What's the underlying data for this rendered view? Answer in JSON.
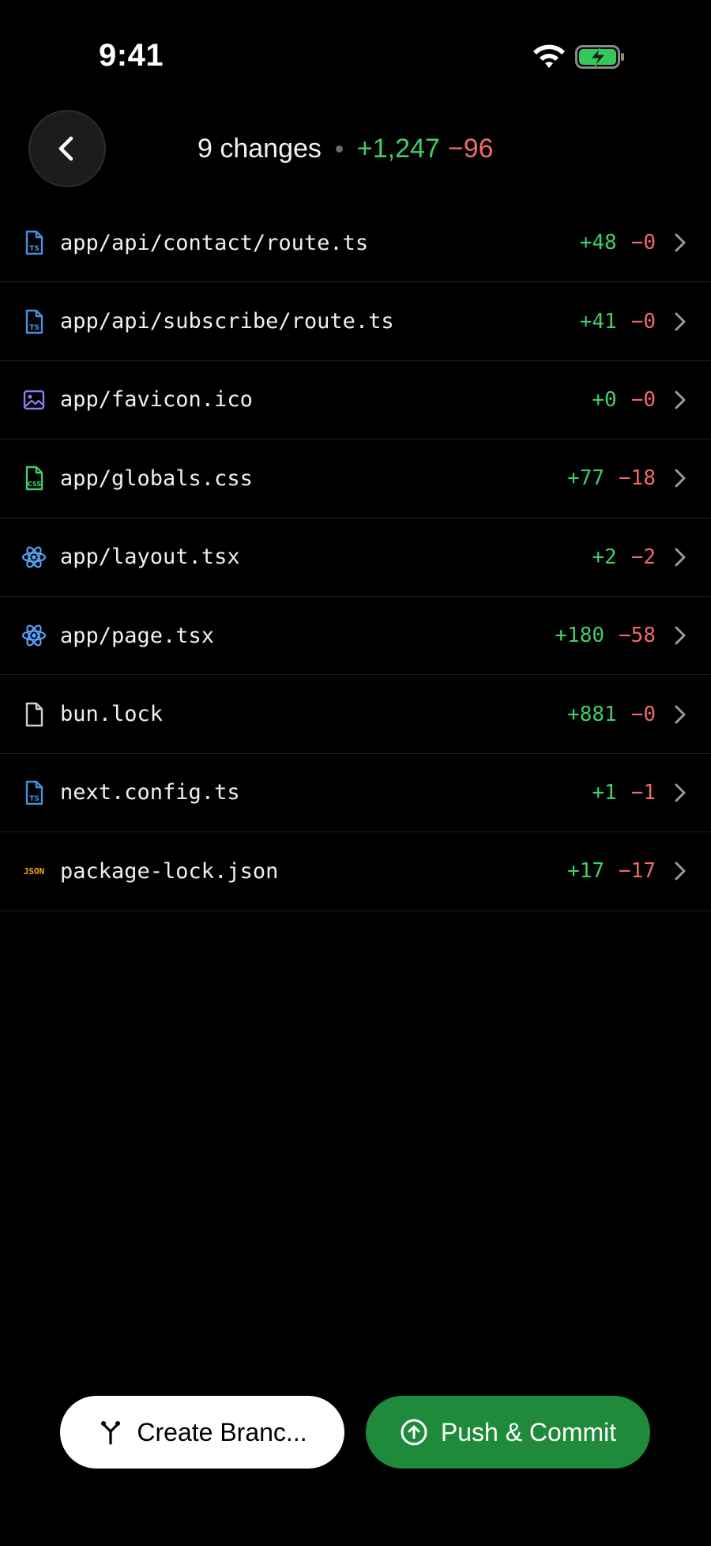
{
  "status_bar": {
    "time": "9:41"
  },
  "header": {
    "changes_label": "9 changes",
    "additions": "+1,247",
    "deletions": "−96"
  },
  "files": [
    {
      "icon": "typescript-file-icon",
      "name": "app/api/contact/route.ts",
      "add": "+48",
      "del": "−0"
    },
    {
      "icon": "typescript-file-icon",
      "name": "app/api/subscribe/route.ts",
      "add": "+41",
      "del": "−0"
    },
    {
      "icon": "image-file-icon",
      "name": "app/favicon.ico",
      "add": "+0",
      "del": "−0"
    },
    {
      "icon": "css-file-icon",
      "name": "app/globals.css",
      "add": "+77",
      "del": "−18"
    },
    {
      "icon": "react-file-icon",
      "name": "app/layout.tsx",
      "add": "+2",
      "del": "−2"
    },
    {
      "icon": "react-file-icon",
      "name": "app/page.tsx",
      "add": "+180",
      "del": "−58"
    },
    {
      "icon": "generic-file-icon",
      "name": "bun.lock",
      "add": "+881",
      "del": "−0"
    },
    {
      "icon": "typescript-file-icon",
      "name": "next.config.ts",
      "add": "+1",
      "del": "−1"
    },
    {
      "icon": "json-file-icon",
      "name": "package-lock.json",
      "add": "+17",
      "del": "−17"
    }
  ],
  "actions": {
    "create_branch_label": "Create Branc...",
    "push_commit_label": "Push & Commit"
  },
  "colors": {
    "addition": "#3fcf6a",
    "deletion": "#f06a6a",
    "push_button": "#1f8a3a",
    "typescript_icon": "#4a90e2",
    "css_icon": "#3fcf6a",
    "react_icon": "#5aa0f0",
    "json_icon": "#f5a623",
    "image_icon": "#8e7cf0"
  }
}
